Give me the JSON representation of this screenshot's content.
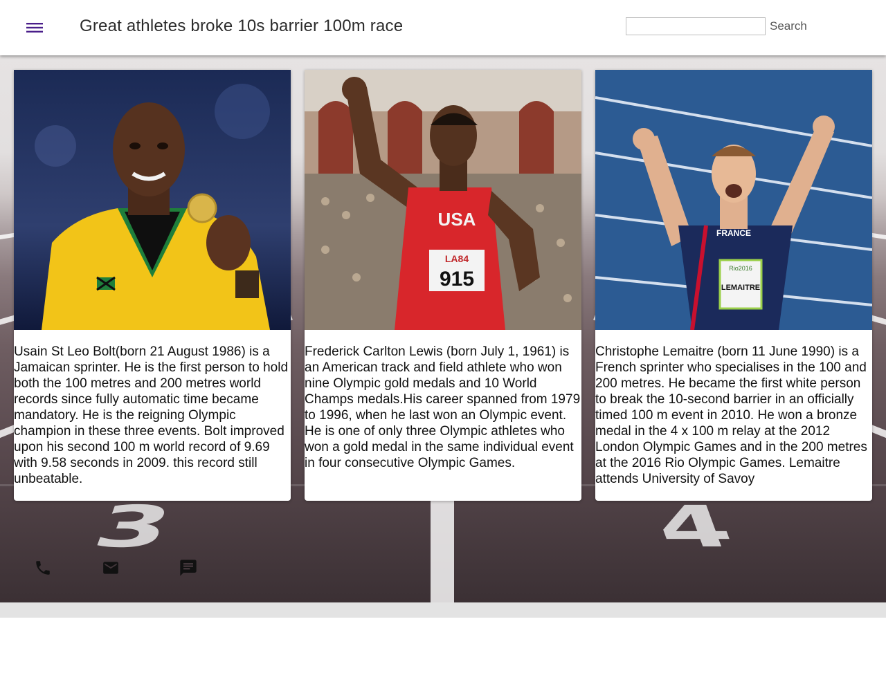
{
  "header": {
    "title": "Great athletes broke 10s barrier 100m race",
    "menu_icon": "hamburger-menu-icon",
    "search": {
      "value": "",
      "placeholder": "",
      "button_label": "Search"
    }
  },
  "cards": [
    {
      "image": "usain-bolt-photo",
      "text": "Usain St Leo Bolt(born 21 August 1986) is a Jamaican sprinter. He is the first person to hold both the 100 metres and 200 metres world records since fully automatic time became mandatory. He is the reigning Olympic champion in these three events. Bolt improved upon his second 100 m world record of 9.69 with 9.58 seconds in 2009. this record still unbeatable."
    },
    {
      "image": "carl-lewis-photo",
      "text": "Frederick Carlton Lewis (born July 1, 1961) is an American track and field athlete who won nine Olympic gold medals and 10 World Champs medals.His career spanned from 1979 to 1996, when he last won an Olympic event. He is one of only three Olympic athletes who won a gold medal in the same individual event in four consecutive Olympic Games.",
      "bib_text": "USA",
      "bib_small": "LA84",
      "bib_number": "915"
    },
    {
      "image": "christophe-lemaitre-photo",
      "text": "Christophe Lemaitre (born 11 June 1990) is a French sprinter who specialises in the 100 and 200 metres. He became the first white person to break the 10-second barrier in an officially timed 100 m event in 2010. He won a bronze medal in the 4 x 100 m relay at the 2012 London Olympic Games and in the 200 metres at the 2016 Rio Olympic Games. Lemaitre attends University of Savoy",
      "jersey_text": "FRANCE",
      "bib_small": "Rio2016",
      "bib_name": "LEMAITRE"
    }
  ],
  "background": {
    "lane_numbers": [
      "3",
      "4"
    ]
  },
  "footer_icons": [
    "phone-icon",
    "mail-icon",
    "chat-icon"
  ],
  "colors": {
    "accent": "#4a1e8a",
    "header_bg": "#ffffff",
    "card_bg": "#ffffff"
  }
}
